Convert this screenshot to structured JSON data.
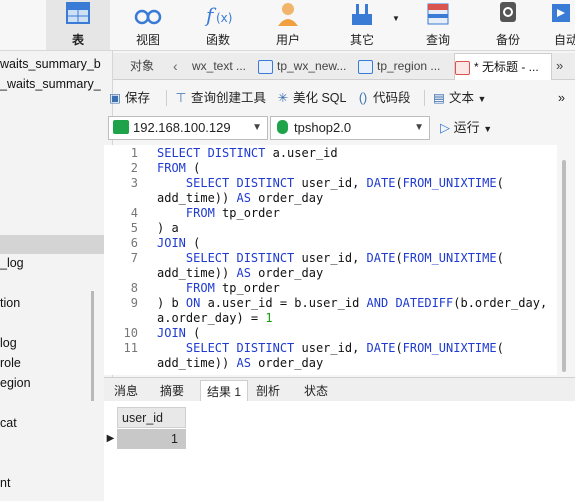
{
  "ribbon": {
    "items": [
      {
        "label": "表",
        "icon": "table-icon",
        "active": true
      },
      {
        "label": "视图",
        "icon": "view-icon"
      },
      {
        "label": "函数",
        "icon": "function-icon"
      },
      {
        "label": "用户",
        "icon": "user-icon"
      },
      {
        "label": "其它",
        "icon": "tools-icon"
      },
      {
        "label": "查询",
        "icon": "query-icon"
      },
      {
        "label": "备份",
        "icon": "backup-icon"
      },
      {
        "label": "自动",
        "icon": "automation-icon"
      }
    ]
  },
  "left_pane": {
    "items": [
      "waits_summary_b",
      "_waits_summary_",
      "",
      "",
      "",
      "_log",
      "tion",
      "log",
      "role",
      "egion",
      "cat",
      "nt"
    ]
  },
  "tabs": {
    "objects_label": "对象",
    "items": [
      "wx_text ...",
      "tp_wx_new...",
      "tp_region ...",
      "* 无标题 - ..."
    ]
  },
  "toolbar": {
    "save": "保存",
    "query_builder": "查询创建工具",
    "beautify": "美化 SQL",
    "snippet": "代码段",
    "text": "文本",
    "more": "»"
  },
  "connection": {
    "host": "192.168.100.129",
    "database": "tpshop2.0",
    "run_label": "运行"
  },
  "editor": {
    "line_numbers": [
      "1",
      "2",
      "3",
      "",
      "4",
      "5",
      "6",
      "7",
      "",
      "8",
      "9",
      "",
      "10",
      "11",
      "",
      ""
    ]
  },
  "bottom_tabs": [
    "消息",
    "摘要",
    "结果 1",
    "剖析",
    "状态"
  ],
  "results": {
    "columns": [
      "user_id"
    ],
    "rows": [
      [
        "1"
      ]
    ]
  },
  "colors": {
    "keyword": "#1f3bd1",
    "number": "#13a10e",
    "accent": "#3a7bd5"
  }
}
